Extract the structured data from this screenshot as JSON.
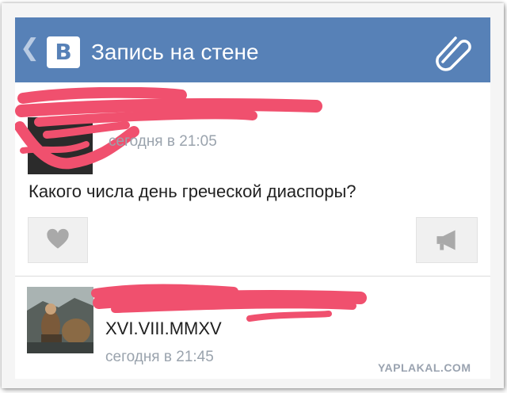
{
  "header": {
    "back_icon": "chevron-left-icon",
    "logo_text": "В",
    "title": "Запись на стене",
    "attach_icon": "paperclip-icon",
    "color": "#5781b7"
  },
  "post": {
    "time": "сегодня в 21:05",
    "text": "Какого числа день греческой диаспоры?",
    "like_icon": "heart-icon",
    "share_icon": "megaphone-icon",
    "scribble_color": "#f0506e"
  },
  "comment": {
    "avatar": "avatar-image",
    "text": "XVI.VIII.MMXV",
    "time": "сегодня в 21:45"
  },
  "watermark": "YAPLAKAL.COM"
}
